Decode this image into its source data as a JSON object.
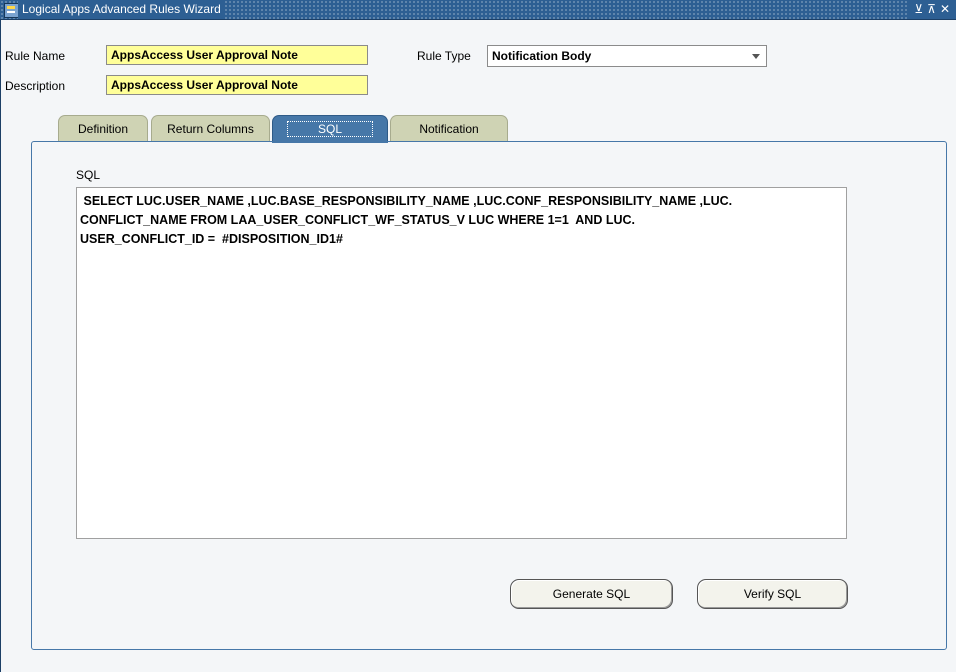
{
  "window": {
    "title": "Logical Apps Advanced Rules Wizard",
    "buttons": [
      "⊻",
      "⊼",
      "✕"
    ]
  },
  "form": {
    "rule_name_label": "Rule Name",
    "rule_name_value": "AppsAccess User Approval Note",
    "description_label": "Description",
    "description_value": "AppsAccess User Approval Note",
    "rule_type_label": "Rule Type",
    "rule_type_value": "Notification Body"
  },
  "tabs": [
    {
      "label": "Definition",
      "active": false
    },
    {
      "label": "Return Columns",
      "active": false
    },
    {
      "label": "SQL",
      "active": true
    },
    {
      "label": "Notification",
      "active": false
    }
  ],
  "sql": {
    "label": "SQL",
    "text": " SELECT LUC.USER_NAME ,LUC.BASE_RESPONSIBILITY_NAME ,LUC.CONF_RESPONSIBILITY_NAME ,LUC.\nCONFLICT_NAME FROM LAA_USER_CONFLICT_WF_STATUS_V LUC WHERE 1=1  AND LUC.\nUSER_CONFLICT_ID =  #DISPOSITION_ID1#"
  },
  "buttons": {
    "generate": "Generate SQL",
    "verify": "Verify SQL"
  },
  "colors": {
    "title_bar": "#2d5f93",
    "active_tab": "#4677a8",
    "inactive_tab": "#cfd3b4",
    "required_field": "#ffff99"
  }
}
